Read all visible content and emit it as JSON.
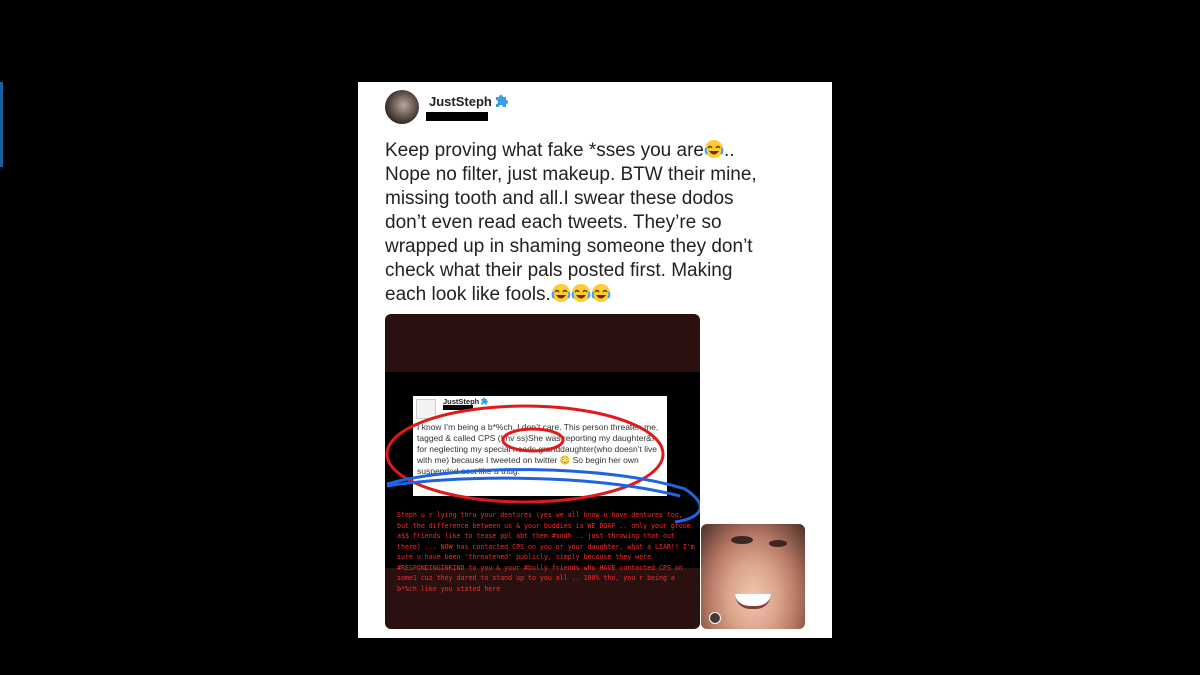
{
  "tweet": {
    "username": "JustSteph",
    "lines": [
      "Keep proving what fake *sses you are",
      "..",
      "Nope no filter, just makeup. BTW their mine,",
      "missing tooth and all.I swear these dodos",
      "don’t even read each tweets. They’re so",
      "wrapped up in shaming someone they don’t",
      "check what their pals posted first. Making",
      "each look like fools."
    ],
    "emoji_name": "face-with-tears-of-joy"
  },
  "embedded_screenshot": {
    "username": "JustSteph",
    "text": "I know I’m being a b*%ch, I don’t care. This person threaten me, tagged & called CPS (I hv ss)She was reporting my daughter&I for neglecting my special needs granddaughter(who doesn’t live with me) because I tweeted on twitter 😳 So begin her own suspended acct like a thug.",
    "red_text": "Steph u r lying thru your dentures (yes we all know u have dentures too, but the difference between us & your buddies is WE DGAF .. only your groom a$$ friends like to tease ppl abt them #sndh .. just throwing that out there) ... NOW has contacted CPS on you or your daughter, what a LIAR!! I'm sure u have been 'threatened' publicly, simply because they were #RESPONDINGINKIND to you & your #bully friends who HAVE contacted CPS on some1 cuz they dared to stand up to you all .. 100% tho, you r being a b*%ch like you stated here"
  },
  "colors": {
    "badge_blue": "#3a9ee6",
    "annotation_red": "#e01919",
    "annotation_blue": "#1e63e0",
    "red_text": "#ff2a2a"
  }
}
